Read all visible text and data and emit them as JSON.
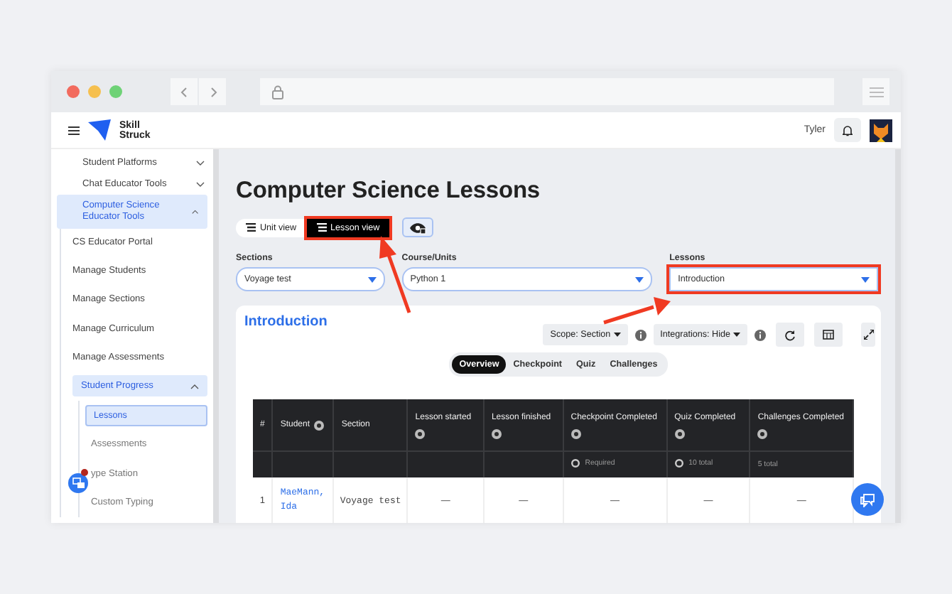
{
  "header": {
    "brand": [
      "Skill",
      "Struck"
    ],
    "user": "Tyler"
  },
  "sidebar": {
    "items": [
      {
        "label": "Student Platforms",
        "expanded": false
      },
      {
        "label": "Chat Educator Tools",
        "expanded": false
      },
      {
        "label": "Computer Science Educator Tools",
        "expanded": true,
        "children": [
          {
            "label": "CS Educator Portal"
          },
          {
            "label": "Manage Students"
          },
          {
            "label": "Manage Sections"
          },
          {
            "label": "Manage Curriculum"
          },
          {
            "label": "Manage Assessments"
          },
          {
            "label": "Student Progress",
            "expanded": true,
            "children": [
              {
                "label": "Lessons",
                "selected": true
              },
              {
                "label": "Assessments",
                "selected": false
              },
              {
                "label": "ype Station",
                "selected": false
              },
              {
                "label": "Custom Typing",
                "selected": false
              }
            ]
          }
        ]
      }
    ]
  },
  "page": {
    "title": "Computer Science Lessons",
    "view_toggle": [
      {
        "label": "Unit view",
        "selected": false,
        "highlighted": false
      },
      {
        "label": "Lesson view",
        "selected": true,
        "highlighted": true
      }
    ],
    "filters": [
      {
        "label": "Sections",
        "value": "Voyage test",
        "highlighted": false
      },
      {
        "label": "Course/Units",
        "value": "Python 1",
        "highlighted": false
      },
      {
        "label": "Lessons",
        "value": "Introduction",
        "highlighted": true
      }
    ]
  },
  "card": {
    "title": "Introduction",
    "dropdowns": [
      {
        "label": "Scope: Section"
      },
      {
        "label": "Integrations: Hide"
      }
    ],
    "tabs": [
      {
        "label": "Overview",
        "selected": true
      },
      {
        "label": "Checkpoint",
        "selected": false
      },
      {
        "label": "Quiz",
        "selected": false
      },
      {
        "label": "Challenges",
        "selected": false
      }
    ],
    "table": {
      "columns": [
        {
          "label": "#",
          "sortable": false
        },
        {
          "label": "Student",
          "sortable": true
        },
        {
          "label": "Section",
          "sortable": false
        },
        {
          "label": "Lesson started",
          "sortable": true
        },
        {
          "label": "Lesson finished",
          "sortable": true
        },
        {
          "label": "Checkpoint Completed",
          "sortable": true,
          "subheader": "Required",
          "radio": true
        },
        {
          "label": "Quiz Completed",
          "sortable": true,
          "subheader": "10 total",
          "radio": true
        },
        {
          "label": "Challenges Completed",
          "sortable": true,
          "subheader": "5 total",
          "radio": false
        }
      ],
      "rows": [
        {
          "cells": [
            "1",
            "MaeMann, Ida",
            "Voyage test",
            "—",
            "—",
            "—",
            "—",
            "—"
          ]
        }
      ]
    }
  }
}
